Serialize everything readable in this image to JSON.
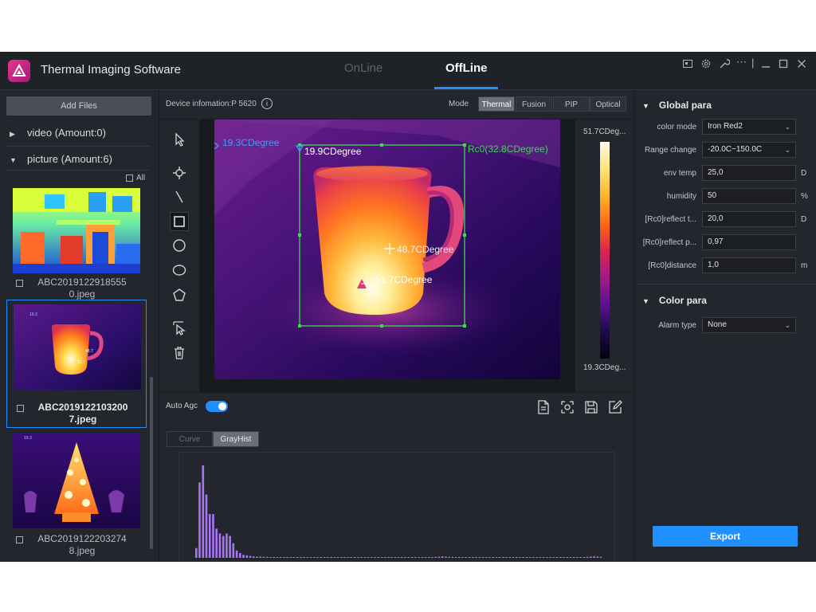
{
  "app": {
    "title": "Thermal Imaging Software"
  },
  "tabs": {
    "online": "OnLine",
    "offline": "OffLine",
    "active": "OffLine"
  },
  "left": {
    "add_files": "Add Files",
    "video_label": "video (Amount:0)",
    "picture_label": "picture (Amount:6)",
    "all_label": "All",
    "files": [
      {
        "name": "ABC2019122918555\n0.jpeg",
        "selected": false
      },
      {
        "name": "ABC2019122103200\n7.jpeg",
        "selected": true
      },
      {
        "name": "ABC2019122203274\n8.jpeg",
        "selected": false
      }
    ]
  },
  "toolbar": {
    "device_info": "Device infomation:P 5620",
    "mode_label": "Mode",
    "modes": [
      "Thermal",
      "Fusion",
      "PIP",
      "Optical"
    ],
    "active_mode": "Thermal"
  },
  "image": {
    "labels": {
      "cursor_temp": "19.3CDegree",
      "box_min": "19.9CDegree",
      "roi": "Rc0(32.8CDegree)",
      "center_temp": "48.7CDegree",
      "max_temp": "51.7CDegree"
    }
  },
  "colorbar": {
    "max": "51.7CDeg...",
    "min": "19.3CDeg..."
  },
  "agc": {
    "label": "Auto Agc",
    "enabled": true
  },
  "hist": {
    "tabs": [
      "Curve",
      "GrayHist"
    ],
    "active": "GrayHist",
    "bar_color": "#a974f5",
    "values": [
      4,
      31,
      38,
      26,
      18,
      18,
      12,
      10,
      9,
      10,
      9,
      6,
      3,
      2,
      1.2,
      1,
      0.8,
      0.6,
      0.5,
      0.5,
      0.4,
      0.4,
      0.3,
      0.3,
      0.3,
      0.3,
      0.3,
      0.3,
      0.3,
      0.3,
      0.3,
      0.3,
      0.2,
      0.2,
      0.2,
      0.2,
      0.2,
      0.2,
      0.2,
      0.2,
      0.2,
      0.2,
      0.2,
      0.2,
      0.2,
      0.2,
      0.2,
      0.2,
      0.2,
      0.2,
      0.2,
      0.2,
      0.2,
      0.2,
      0.2,
      0.2,
      0.2,
      0.2,
      0.2,
      0.2,
      0.2,
      0.2,
      0.2,
      0.2,
      0.2,
      0.2,
      0.2,
      0.2,
      0.2,
      0.2,
      0.3,
      0.4,
      0.5,
      0.6,
      0.5,
      0.4,
      0.4,
      0.3,
      0.3,
      0.3,
      0.3,
      0.3,
      0.3,
      0.3,
      0.3,
      0.3,
      0.3,
      0.3,
      0.3,
      0.3,
      0.3,
      0.3,
      0.3,
      0.3,
      0.3,
      0.3,
      0.3,
      0.3,
      0.3,
      0.3,
      0.3,
      0.3,
      0.3,
      0.3,
      0.3,
      0.3,
      0.3,
      0.3,
      0.3,
      0.3,
      0.3,
      0.3,
      0.3,
      0.3,
      0.3,
      0.3,
      0.4,
      0.5,
      0.6,
      0.5,
      0.4
    ]
  },
  "global_para": {
    "title": "Global para",
    "color_mode": {
      "label": "color mode",
      "value": "Iron Red2"
    },
    "range_change": {
      "label": "Range change",
      "value": "-20.0C~150.0C"
    },
    "env_temp": {
      "label": "env temp",
      "value": "25,0",
      "unit": "D"
    },
    "humidity": {
      "label": "humidity",
      "value": "50",
      "unit": "%"
    },
    "reflect_t": {
      "label": "[Rc0]reflect t...",
      "value": "20,0",
      "unit": "D"
    },
    "reflect_p": {
      "label": "[Rc0]reflect p...",
      "value": "0,97",
      "unit": ""
    },
    "distance": {
      "label": "[Rc0]distance",
      "value": "1,0",
      "unit": "m"
    }
  },
  "color_para": {
    "title": "Color para",
    "alarm_type": {
      "label": "Alarm type",
      "value": "None"
    }
  },
  "export": "Export",
  "colors": {
    "accent": "#1e90ff",
    "roi_box": "#3ddc4a",
    "cursor_label": "#3aa0ff"
  }
}
